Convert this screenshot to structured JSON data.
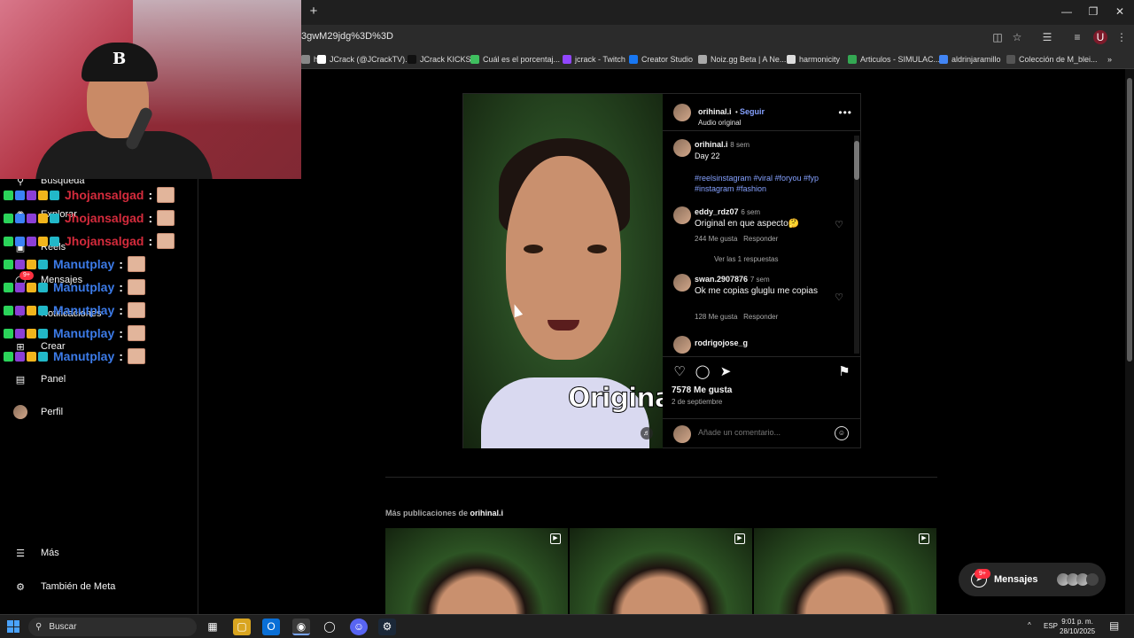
{
  "browser": {
    "url": "3gwM29jdg%3D%3D",
    "bookmarks": [
      {
        "label": "h",
        "color": "#888888"
      },
      {
        "label": "JCrack (@JCrackTV)...",
        "color": "#ffffff"
      },
      {
        "label": "JCrack KICKS",
        "color": "#111111"
      },
      {
        "label": "Cuál es el porcentaj...",
        "color": "#3fbf5f"
      },
      {
        "label": "jcrack - Twitch",
        "color": "#9146ff"
      },
      {
        "label": "Creator Studio",
        "color": "#1877f2"
      },
      {
        "label": "Noiz.gg Beta | A Ne...",
        "color": "#aaaaaa"
      },
      {
        "label": "harmonicity",
        "color": "#dddddd"
      },
      {
        "label": "Articulos - SIMULAC...",
        "color": "#34a853"
      },
      {
        "label": "aldrinjaramillo",
        "color": "#4285f4"
      },
      {
        "label": "Colección de M_blei...",
        "color": "#555555"
      }
    ]
  },
  "sidebar": {
    "items": [
      {
        "label": "Búsqueda",
        "icon": "search-icon"
      },
      {
        "label": "Explorar",
        "icon": "compass-icon"
      },
      {
        "label": "Reels",
        "icon": "reels-icon"
      },
      {
        "label": "Mensajes",
        "icon": "messenger-icon",
        "badge": "9+"
      },
      {
        "label": "Notificaciones",
        "icon": "heart-icon"
      },
      {
        "label": "Crear",
        "icon": "plus-icon"
      },
      {
        "label": "Panel",
        "icon": "chart-icon"
      },
      {
        "label": "Perfil",
        "icon": "avatar-icon"
      }
    ],
    "bottom": [
      {
        "label": "Más",
        "icon": "menu-icon"
      },
      {
        "label": "También de Meta",
        "icon": "meta-icon"
      }
    ]
  },
  "chat": [
    {
      "name": "Jhojansalgad",
      "color": "red"
    },
    {
      "name": "Jhojansalgad",
      "color": "red"
    },
    {
      "name": "Jhojansalgad",
      "color": "red"
    },
    {
      "name": "Manutplay",
      "color": "blue"
    },
    {
      "name": "Manutplay",
      "color": "blue"
    },
    {
      "name": "Manutplay",
      "color": "blue"
    },
    {
      "name": "Manutplay",
      "color": "blue"
    },
    {
      "name": "Manutplay",
      "color": "blue"
    }
  ],
  "post": {
    "author": "orihinal.i",
    "follow": "Seguir",
    "audio": "Audio original",
    "overlay_text": "Original",
    "caption": {
      "author": "orihinal.i",
      "time": "8 sem",
      "text": "Day 22",
      "tags": "#reelsinstagram #viral #foryou #fyp #instagram #fashion"
    },
    "comments": [
      {
        "user": "eddy_rdz07",
        "time": "6 sem",
        "text": "Original en que aspecto🤔",
        "likes": "244 Me gusta",
        "reply": "Responder",
        "replies": "Ver las 1 respuestas"
      },
      {
        "user": "swan.2907876",
        "time": "7 sem",
        "text": "Ok me copias gluglu me copias",
        "likes": "128 Me gusta",
        "reply": "Responder"
      },
      {
        "user": "rodrigojose_g",
        "time": "",
        "text": ""
      }
    ],
    "likes": "7578 Me gusta",
    "date": "2 de septiembre",
    "comment_placeholder": "Añade un comentario..."
  },
  "more": {
    "prefix": "Más publicaciones de",
    "author": "orihinal.i"
  },
  "messages_pill": {
    "label": "Mensajes",
    "badge": "9+"
  },
  "taskbar": {
    "search": "Buscar",
    "lang": "ESP",
    "time": "9:01 p. m.",
    "date": "28/10/2025"
  }
}
